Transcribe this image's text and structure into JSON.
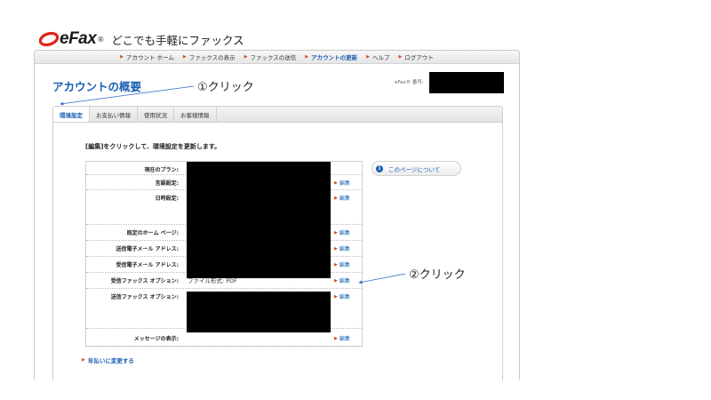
{
  "brand": {
    "logo_text": "eFax",
    "logo_reg": "®",
    "tagline": "どこでも手軽にファックス"
  },
  "nav": [
    {
      "label": "アカウント ホーム"
    },
    {
      "label": "ファックスの表示"
    },
    {
      "label": "ファックスの送信"
    },
    {
      "label": "アカウントの更新"
    },
    {
      "label": "ヘルプ"
    },
    {
      "label": "ログアウト"
    }
  ],
  "header": {
    "title": "アカウントの概要",
    "fax_number_label": "eFax® 番号:"
  },
  "tabs": [
    {
      "label": "環境設定"
    },
    {
      "label": "お支払い情報"
    },
    {
      "label": "使用状況"
    },
    {
      "label": "お客様情報"
    }
  ],
  "content": {
    "instruction": "[編集]をクリックして、環境設定を更新します。",
    "rows": [
      {
        "label": "現在のプラン:",
        "value": "",
        "edit": ""
      },
      {
        "label": "言語設定:",
        "value": "",
        "edit": "編集"
      },
      {
        "label": "日時設定:",
        "value": "",
        "edit": "編集"
      },
      {
        "label": "既定のホーム ページ:",
        "value": "",
        "edit": "編集"
      },
      {
        "label": "送信電子メール アドレス:",
        "value": "",
        "edit": "編集"
      },
      {
        "label": "受信電子メール アドレス:",
        "value": "",
        "edit": "編集"
      },
      {
        "label": "受信ファックス オプション:",
        "value": "ファイル形式: PDF",
        "edit": "編集"
      },
      {
        "label": "送信ファックス オプション:",
        "value": "",
        "edit": "編集"
      },
      {
        "label": "メッセージの表示:",
        "value": "",
        "edit": "編集"
      }
    ],
    "about_button": "このページについて",
    "annual_link": "年払いに変更する"
  },
  "annotations": {
    "first": "①クリック",
    "second": "②クリック"
  },
  "colors": {
    "accent": "#1a5fb4",
    "arrow_marker": "#d64a1e",
    "logo_red": "#e2231a",
    "mask": "#000000"
  }
}
